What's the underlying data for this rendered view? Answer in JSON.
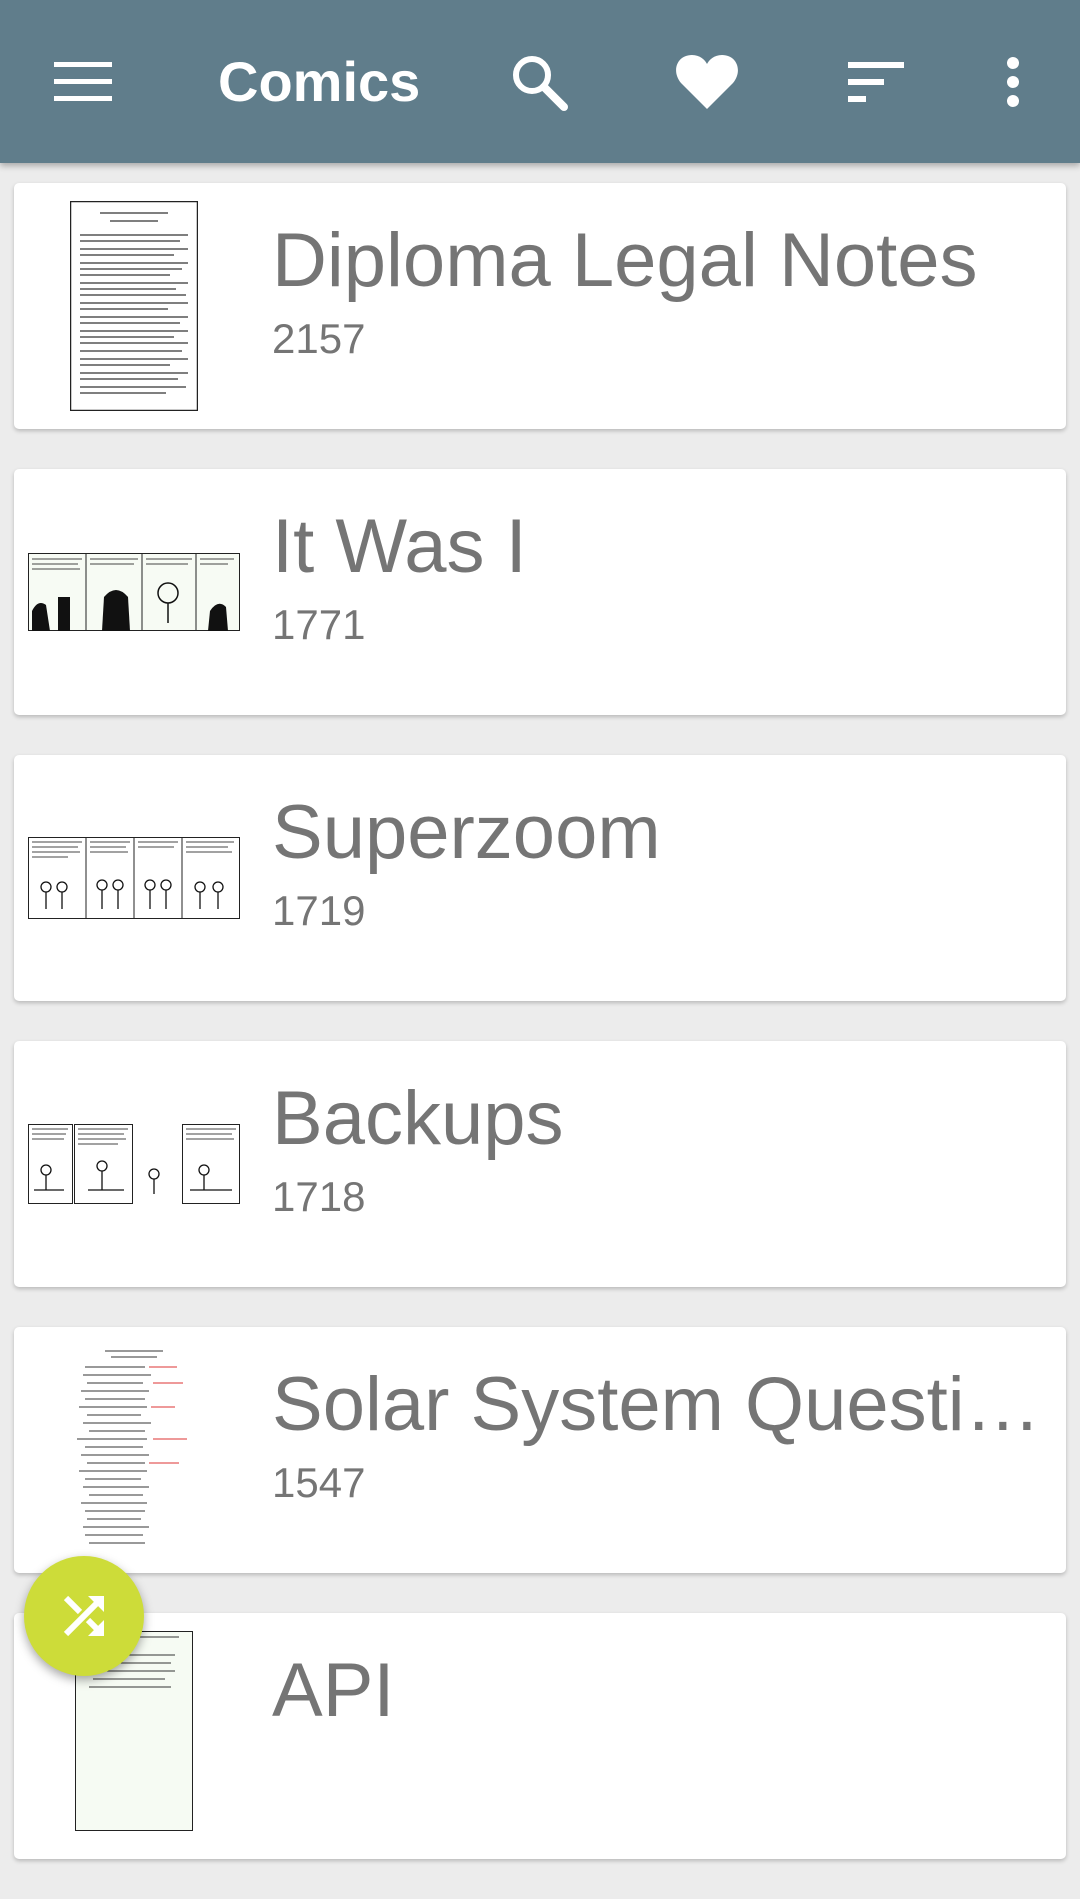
{
  "appbar": {
    "title": "Comics",
    "icons": [
      "menu-icon",
      "search-icon",
      "heart-icon",
      "sort-icon",
      "more-vert-icon"
    ]
  },
  "comics": [
    {
      "title": "Diploma Legal Notes",
      "number": "2157"
    },
    {
      "title": "It Was I",
      "number": "1771"
    },
    {
      "title": "Superzoom",
      "number": "1719"
    },
    {
      "title": "Backups",
      "number": "1718"
    },
    {
      "title": "Solar System Questions",
      "number": "1547"
    },
    {
      "title": "API",
      "number": ""
    }
  ],
  "fab": {
    "icon": "shuffle-icon"
  },
  "colors": {
    "appbar": "#607d8b",
    "fab": "#cddc39",
    "text": "#757575"
  }
}
